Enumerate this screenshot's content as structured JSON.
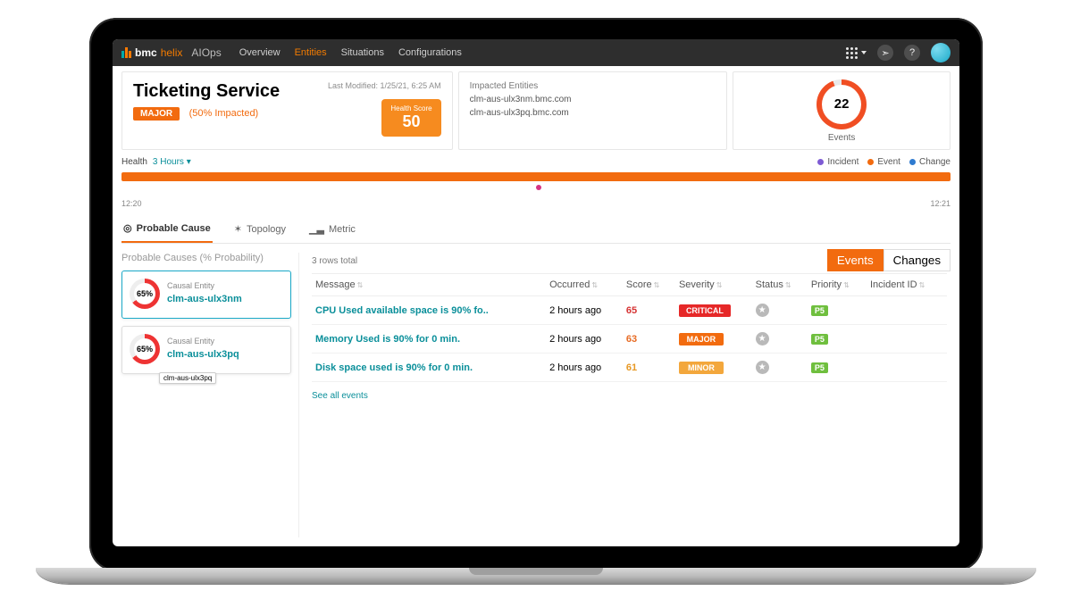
{
  "nav": {
    "brand_main": "bmc",
    "brand_sub": "helix",
    "product": "AIOps",
    "items": [
      {
        "label": "Overview",
        "active": false
      },
      {
        "label": "Entities",
        "active": true
      },
      {
        "label": "Situations",
        "active": false
      },
      {
        "label": "Configurations",
        "active": false
      }
    ]
  },
  "service": {
    "title": "Ticketing Service",
    "severity_badge": "MAJOR",
    "impacted_pct_text": "(50% Impacted)",
    "last_modified_label": "Last Modified: 1/25/21, 6:25 AM",
    "health_score_label": "Health Score",
    "health_score_value": "50"
  },
  "impacted": {
    "title": "Impacted Entities",
    "items": [
      "clm-aus-ulx3nm.bmc.com",
      "clm-aus-ulx3pq.bmc.com"
    ]
  },
  "events_card": {
    "count": "22",
    "label": "Events"
  },
  "health": {
    "label": "Health",
    "range": "3 Hours",
    "legend": {
      "incident": "Incident",
      "event": "Event",
      "change": "Change"
    },
    "time_start": "12:20",
    "time_end": "12:21"
  },
  "tabs": {
    "probable_cause": "Probable Cause",
    "topology": "Topology",
    "metric": "Metric"
  },
  "causes": {
    "heading": "Probable Causes",
    "sub": "(% Probability)",
    "label_entity": "Causal Entity",
    "items": [
      {
        "pct": "65%",
        "name": "clm-aus-ulx3nm",
        "selected": true
      },
      {
        "pct": "65%",
        "name": "clm-aus-ulx3pq",
        "selected": false,
        "tooltip": "clm-aus-ulx3pq"
      }
    ]
  },
  "events": {
    "toggle": {
      "events": "Events",
      "changes": "Changes"
    },
    "rows_total": "3 rows total",
    "columns": {
      "message": "Message",
      "occurred": "Occurred",
      "score": "Score",
      "severity": "Severity",
      "status": "Status",
      "priority": "Priority",
      "incident": "Incident ID"
    },
    "rows": [
      {
        "msg": "CPU Used available space is 90% fo..",
        "occurred": "2 hours ago",
        "score": "65",
        "sev": "CRITICAL",
        "sev_cls": "crit",
        "score_cls": "sc65",
        "pri": "P5"
      },
      {
        "msg": "Memory Used is 90% for 0 min.",
        "occurred": "2 hours ago",
        "score": "63",
        "sev": "MAJOR",
        "sev_cls": "maj",
        "score_cls": "sc63",
        "pri": "P5"
      },
      {
        "msg": "Disk space used is 90% for 0 min.",
        "occurred": "2 hours ago",
        "score": "61",
        "sev": "MINOR",
        "sev_cls": "min",
        "score_cls": "sc61",
        "pri": "P5"
      }
    ],
    "see_all": "See all events"
  }
}
